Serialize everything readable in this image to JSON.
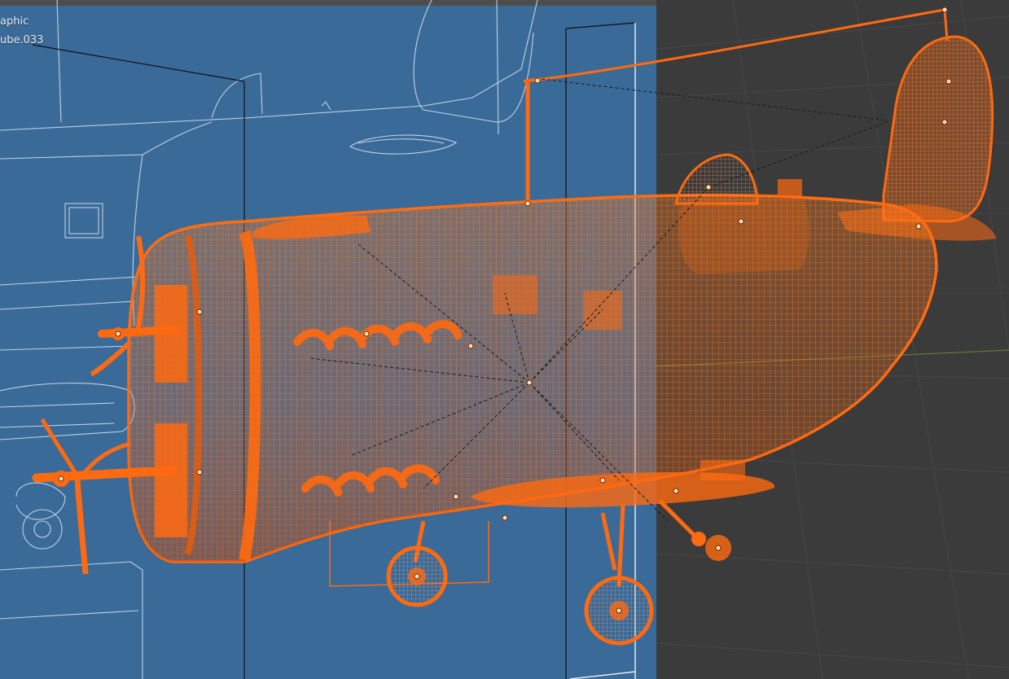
{
  "viewport": {
    "view_mode_label": "aphic",
    "active_object_label": "ube.033",
    "colors": {
      "background": "#3b3b3b",
      "reference_image": "#3a6a98",
      "selection_orange": "#ff6a10",
      "selection_dark": "#c84a06",
      "wire_white": "#d9e4ef",
      "grid": "#4a4a4a"
    },
    "objects": [
      {
        "name": "aircraft-fuselage",
        "state": "selected"
      },
      {
        "name": "reference-image-plane",
        "state": "unselected"
      }
    ]
  }
}
